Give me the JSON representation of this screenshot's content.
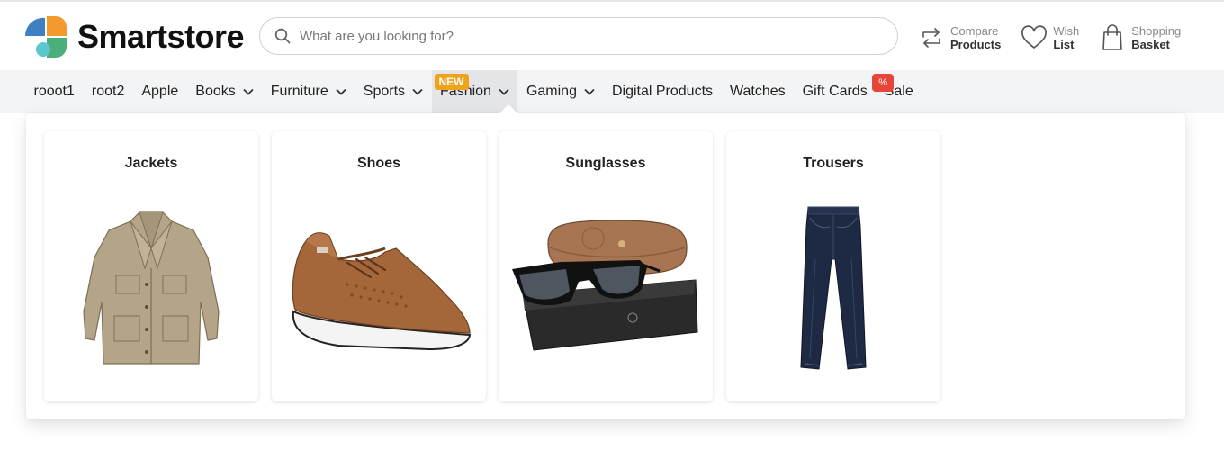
{
  "brand": {
    "name": "Smartstore"
  },
  "search": {
    "placeholder": "What are you looking for?"
  },
  "header_actions": [
    {
      "line1": "Compare",
      "line2": "Products",
      "icon": "compare-icon"
    },
    {
      "line1": "Wish",
      "line2": "List",
      "icon": "heart-icon"
    },
    {
      "line1": "Shopping",
      "line2": "Basket",
      "icon": "shopping-bag-icon"
    }
  ],
  "nav": {
    "items": [
      {
        "label": "rooot1"
      },
      {
        "label": "root2"
      },
      {
        "label": "Apple"
      },
      {
        "label": "Books",
        "dropdown": true
      },
      {
        "label": "Furniture",
        "dropdown": true
      },
      {
        "label": "Sports",
        "dropdown": true
      },
      {
        "label": "Fashion",
        "dropdown": true,
        "badge": "NEW",
        "active": true
      },
      {
        "label": "Gaming",
        "dropdown": true
      },
      {
        "label": "Digital Products"
      },
      {
        "label": "Watches"
      },
      {
        "label": "Gift Cards"
      },
      {
        "label": "Sale",
        "badge": "%"
      }
    ]
  },
  "dropdown": {
    "categories": [
      {
        "title": "Jackets",
        "image": "jacket-image"
      },
      {
        "title": "Shoes",
        "image": "sneaker-image"
      },
      {
        "title": "Sunglasses",
        "image": "sunglasses-image"
      },
      {
        "title": "Trousers",
        "image": "jeans-image"
      }
    ]
  },
  "colors": {
    "nav_bg": "#f3f4f6",
    "badge_new": "#f0a21a",
    "badge_sale": "#e8453a",
    "logo_blue": "#3f7fc4",
    "logo_orange": "#f29a2e",
    "logo_green": "#4caf7a",
    "logo_teal": "#5cc6cf"
  }
}
